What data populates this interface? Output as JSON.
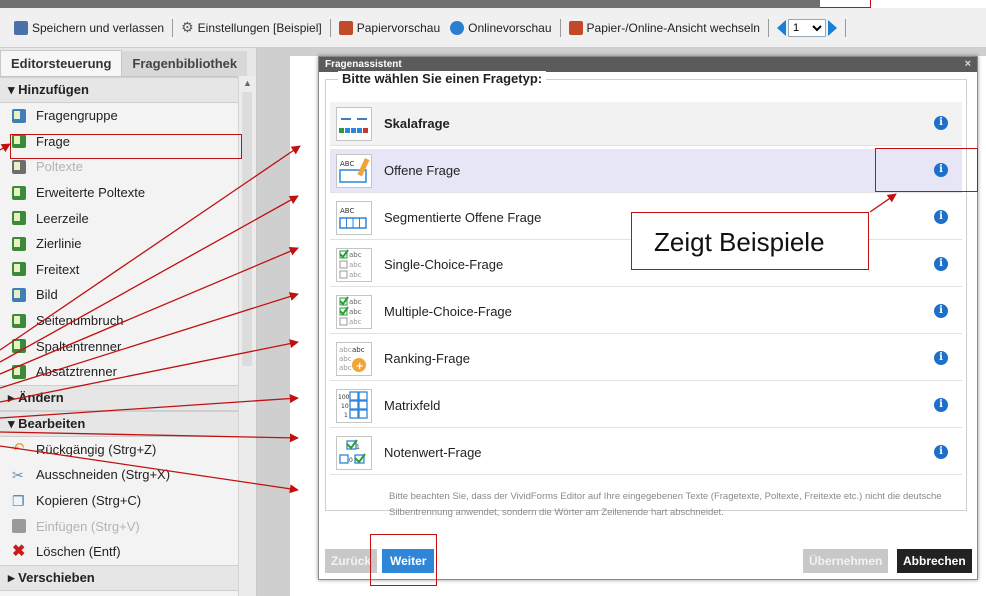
{
  "toolbar": {
    "save_label": "Speichern und verlassen",
    "settings_label": "Einstellungen [Beispiel]",
    "paper_preview_label": "Papiervorschau",
    "online_preview_label": "Onlinevorschau",
    "switch_view_label": "Papier-/Online-Ansicht wechseln",
    "page_value": "1",
    "icons": {
      "save": "save-icon",
      "settings": "gear-icon",
      "paper": "pdf-icon",
      "online": "globe-icon",
      "switch": "pdf-switch-icon"
    }
  },
  "sidebar": {
    "tabs": [
      "Editorsteuerung",
      "Fragenbibliothek"
    ],
    "active_tab": "Editorsteuerung",
    "sections": {
      "add": {
        "title": "Hinzufügen",
        "items": [
          {
            "label": "Fragengruppe",
            "icon": "question-group-icon"
          },
          {
            "label": "Frage",
            "icon": "question-icon"
          },
          {
            "label": "Poltexte",
            "icon": "poltext-icon"
          },
          {
            "label": "Erweiterte Poltexte",
            "icon": "extended-poltext-icon"
          },
          {
            "label": "Leerzeile",
            "icon": "empty-line-icon"
          },
          {
            "label": "Zierlinie",
            "icon": "decorative-line-icon"
          },
          {
            "label": "Freitext",
            "icon": "free-text-icon"
          },
          {
            "label": "Bild",
            "icon": "image-icon"
          },
          {
            "label": "Seitenumbruch",
            "icon": "page-break-icon"
          },
          {
            "label": "Spaltentrenner",
            "icon": "column-separator-icon"
          },
          {
            "label": "Absatztrenner",
            "icon": "paragraph-separator-icon"
          }
        ]
      },
      "change": {
        "title": "Ändern"
      },
      "edit": {
        "title": "Bearbeiten",
        "items": [
          {
            "label": "Rückgängig (Strg+Z)",
            "icon": "undo-icon"
          },
          {
            "label": "Ausschneiden (Strg+X)",
            "icon": "scissors-icon"
          },
          {
            "label": "Kopieren (Strg+C)",
            "icon": "copy-icon"
          },
          {
            "label": "Einfügen (Strg+V)",
            "icon": "paste-icon"
          },
          {
            "label": "Löschen (Entf)",
            "icon": "delete-icon"
          }
        ]
      },
      "move": {
        "title": "Verschieben"
      }
    }
  },
  "dialog": {
    "title": "Fragenassistent",
    "close": "×",
    "prompt": "Bitte wählen Sie einen Fragetyp:",
    "types": [
      {
        "label": "Skalafrage",
        "icon": "scale-question-icon"
      },
      {
        "label": "Offene Frage",
        "icon": "open-question-icon"
      },
      {
        "label": "Segmentierte Offene Frage",
        "icon": "segmented-open-question-icon"
      },
      {
        "label": "Single-Choice-Frage",
        "icon": "single-choice-icon"
      },
      {
        "label": "Multiple-Choice-Frage",
        "icon": "multiple-choice-icon"
      },
      {
        "label": "Ranking-Frage",
        "icon": "ranking-icon"
      },
      {
        "label": "Matrixfeld",
        "icon": "matrix-icon"
      },
      {
        "label": "Notenwert-Frage",
        "icon": "grade-value-icon"
      }
    ],
    "note": "Bitte beachten Sie, dass der VividForms Editor auf Ihre eingegebenen Texte (Fragetexte, Poltexte, Freitexte etc.) nicht die deutsche Silbentrennung anwendet, sondern die Wörter am Zeilenende hart abschneidet.",
    "buttons": {
      "back": "Zurück",
      "next": "Weiter",
      "apply": "Übernehmen",
      "cancel": "Abbrechen"
    }
  },
  "annotation": {
    "callout": "Zeigt Beispiele",
    "color": "#c01010"
  },
  "colors": {
    "accent_blue": "#2f86d8",
    "info_blue": "#1e6fc9",
    "dialog_header": "#5b5b5b"
  }
}
